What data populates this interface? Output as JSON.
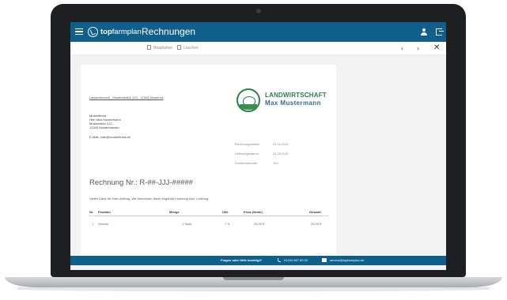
{
  "app": {
    "brand_bold": "top",
    "brand_rest": "farmplan",
    "title": "Rechnungen"
  },
  "toolbar": {
    "edit_label": "Bearbeiten",
    "delete_label": "Löschen",
    "prev": "‹",
    "next": "›",
    "close": "✕"
  },
  "invoice": {
    "sender_line": "Landwirtschaft - Musterstraße 123 - 12345 Musterort",
    "recipient": [
      "Musterfirma",
      "Herr Max Mustermann",
      "Musterallee 123",
      "12345 Musterhausen",
      "",
      "E-Mail: max@musterfirma.de"
    ],
    "logo_line1": "LANDWIRTSCHAFT",
    "logo_line2": "Max Mustermann",
    "meta": [
      {
        "label": "Rechnungsdatum",
        "value": "01.04.2021"
      },
      {
        "label": "Lieferungsdatum",
        "value": "01.04.2021"
      },
      {
        "label": "Kundennummer",
        "value": "123"
      }
    ],
    "title": "Rechnung Nr.: R-##-JJJ-#####",
    "intro": "Vielen Dank für Ihren Auftrag. Wir berechnen Ihnen folgende Lieferung bzw. Leistung:",
    "columns": {
      "nr": "Nr.",
      "position": "Position",
      "menge": "Menge",
      "ust": "USt.",
      "preis": "Preis (Netto)",
      "gesamt": "Gesamt"
    },
    "rows": [
      {
        "nr": "1",
        "position": "Weizen",
        "menge": "1 Sack",
        "ust": "7 %",
        "preis": "25,00 €",
        "gesamt": "25,00 €"
      }
    ]
  },
  "footer": {
    "question": "Fragen oder Hilfe benötigt?",
    "phone": "01234 567 89 00",
    "email": "service@topfarmplan.de"
  }
}
